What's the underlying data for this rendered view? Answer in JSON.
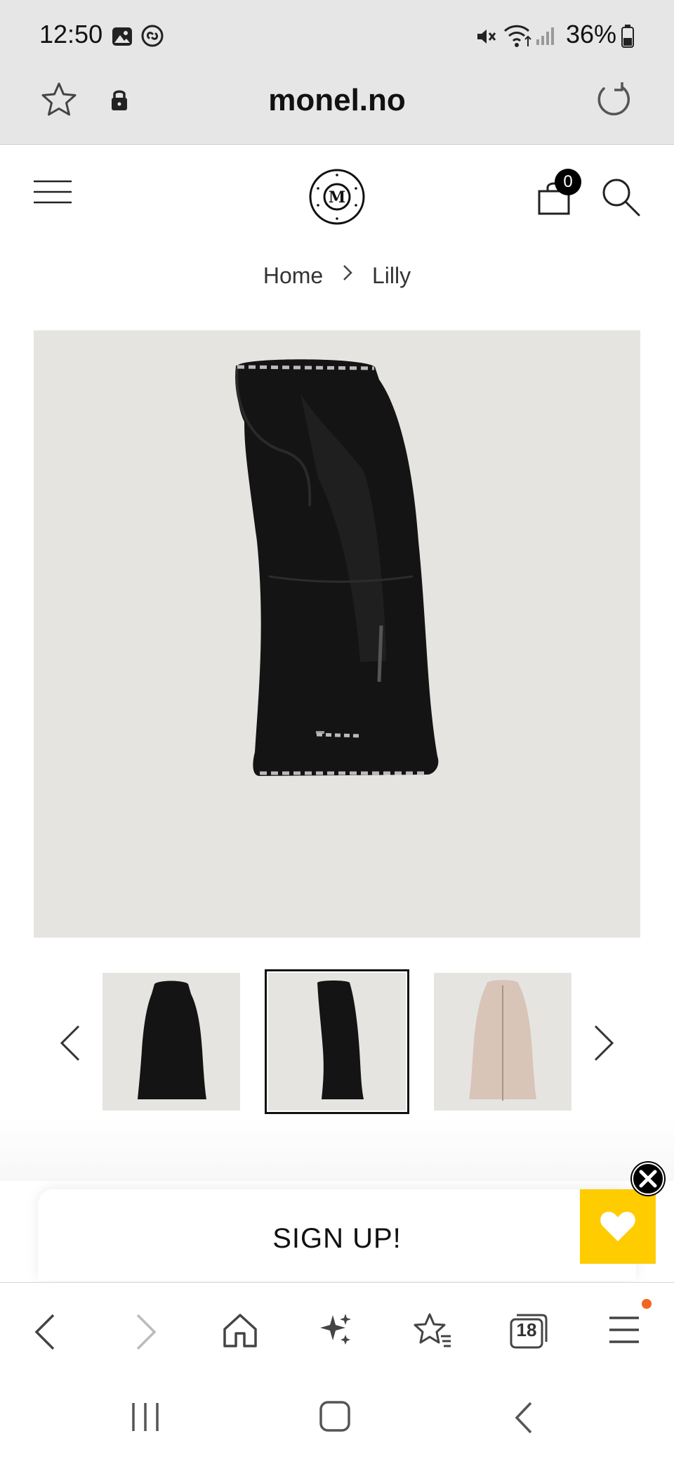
{
  "status_bar": {
    "time": "12:50",
    "battery": "36%",
    "icons": [
      "gallery-icon",
      "shazam-icon",
      "mute-icon",
      "wifi-icon",
      "signal-icon",
      "battery-icon"
    ]
  },
  "browser": {
    "url": "monel.no",
    "tab_count": "18"
  },
  "header": {
    "cart_count": "0",
    "logo_letter": "M"
  },
  "breadcrumb": {
    "home": "Home",
    "current": "Lilly"
  },
  "gallery": {
    "thumbnails": [
      {
        "name": "thumb-black-front",
        "color": "#1a1a1a"
      },
      {
        "name": "thumb-black-side",
        "color": "#1a1a1a"
      },
      {
        "name": "thumb-beige-front",
        "color": "#d9c4b8"
      }
    ],
    "selected_index": 1
  },
  "signup": {
    "label": "SIGN UP!"
  },
  "colors": {
    "accent": "#ffcc00",
    "notification": "#f26522",
    "image_bg": "#e6e4e1"
  }
}
